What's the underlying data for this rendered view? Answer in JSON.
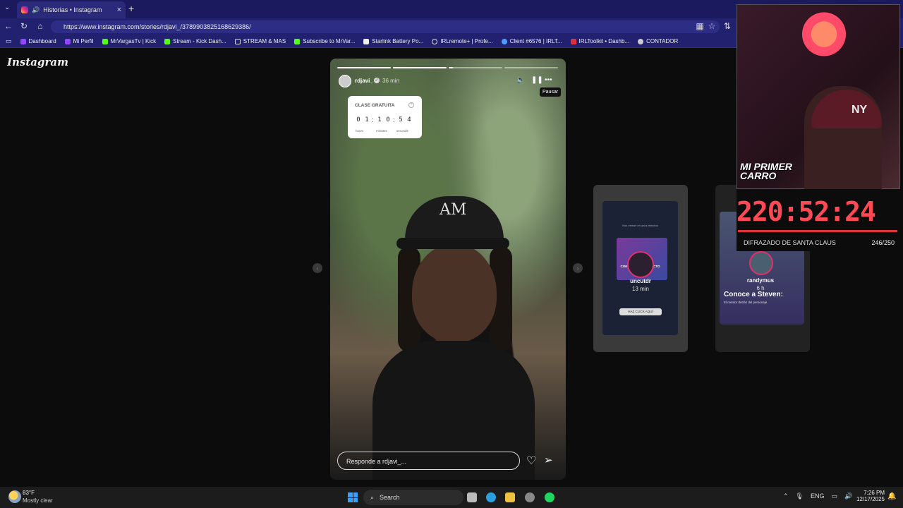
{
  "browser": {
    "tab_title": "Historias • Instagram",
    "url": "https://www.instagram.com/stories/rdjavi_/3789903825168629386/",
    "bookmarks": [
      "Dashboard",
      "Mi Perfil",
      "MrVargasTv | Kick",
      "Stream - Kick Dash...",
      "STREAM & MAS",
      "Subscribe to MrVar...",
      "Starlink Battery Po...",
      "IRLremote+ | Profe...",
      "Client #6576 | IRLT...",
      "IRLToolkit • Dashb...",
      "CONTADOR"
    ]
  },
  "instagram": {
    "logo": "Instagram",
    "story": {
      "username": "rdjavi_",
      "time": "36 min",
      "tooltip": "Pausar",
      "sticker": {
        "title": "CLASE GRATUITA",
        "digits": [
          "0",
          "1",
          "1",
          "0",
          "5",
          "4"
        ],
        "units": [
          "hours",
          "minutes",
          "seconds"
        ]
      },
      "cap_logo": "AM",
      "reply_placeholder": "Responde a rdjavi_..."
    },
    "next_stories": [
      {
        "name": "uncutdr",
        "time": "13 min",
        "caption": "Nos vemos en unos minutos",
        "cta": "HAZ CLICK AQUÍ",
        "banner": "CONTENIDO DE IMPACTO"
      },
      {
        "name": "randymus",
        "time": "6 h",
        "headline": "Conoce a Steven:",
        "sub": "El mentor detrás del personaje"
      }
    ]
  },
  "stream_overlay": {
    "cam_caption_1": "MI PRIMER",
    "cam_caption_2": "CARRO",
    "cap_text": "NY",
    "timer": "220:52:24",
    "task": "DIFRAZADO DE SANTA CLAUS",
    "count": "246/250"
  },
  "taskbar": {
    "temp": "83°F",
    "weather": "Mostly clear",
    "search": "Search",
    "lang": "ENG",
    "time": "7:26 PM",
    "date": "12/17/2025"
  },
  "colors": {
    "accent_red": "#ff4a55",
    "browser_bg": "#222170"
  }
}
